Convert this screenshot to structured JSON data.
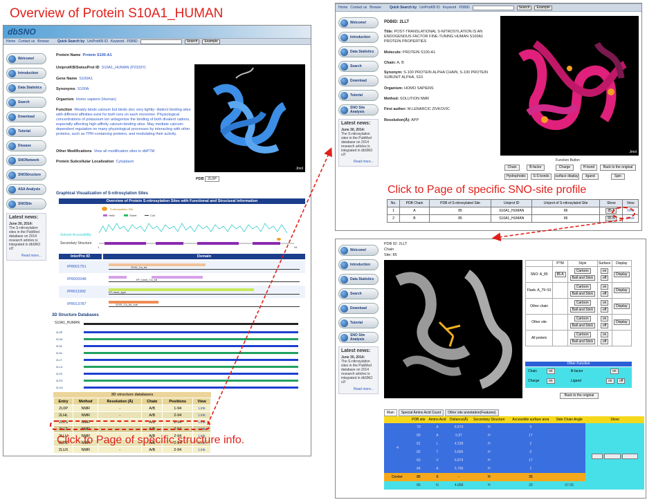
{
  "headline": "Overview of Protein S10A1_HUMAN",
  "callouts": {
    "structure": "Click to Page of specific structure info.",
    "sno": "Click to Page of specific SNO-site profile"
  },
  "nav": {
    "items": [
      "Home",
      "Contact us",
      "Browse"
    ],
    "quick_search": "Quick Search by",
    "options": [
      "UniProtKB ID",
      "Keyword",
      "PDBID"
    ],
    "search_btn": "Search",
    "example_btn": "Example"
  },
  "sidebar_main": [
    "Welcome!",
    "Introduction",
    "Data Statistics",
    "Search",
    "Download",
    "Tutorial",
    "Disease",
    "SNONetwork",
    "SNOStructure",
    "ASA Analysis",
    "SNOSite"
  ],
  "sidebar_pdb": [
    "Welcome!",
    "Introduction",
    "Data Statistics",
    "Search",
    "Download",
    "Tutorial",
    "SNO Site Analysis"
  ],
  "news": {
    "title": "Latest news:",
    "date": "June 30, 2014:",
    "text": "The S-nitrosylation sites in the PubMed database on 2014 research articles is integrated in dbSNO v2!",
    "more": "Read more..."
  },
  "protein": {
    "name_label": "Protein Name",
    "name": "Protein S100-A1",
    "uniprot_label": "UniprotKB/SwissProt ID",
    "uniprot": "S10A1_HUMAN (P23297)",
    "gene_label": "Gene Name",
    "gene": "S100A1",
    "syn_label": "Synonyms",
    "syn": "S100A",
    "org_label": "Organism",
    "org": "Homo sapiens (Human)",
    "func_label": "Function",
    "func": "Weakly binds calcium but binds zinc very tightly- distinct binding sites with different affinities exist for both ions on each monomer. Physiological concentrations of potassium ion antagonize the binding of both divalent cations, especially affecting high-affinity calcium-binding sites. May mediate calcium-dependent regulation on many physiological processes by interacting with other proteins, such as TPR-containing proteins, and modulating their activity.",
    "mod_label": "Other Modifications",
    "mod": "View all modification sites in dbPTM",
    "loc_label": "Protein Subcellular Localization",
    "loc": "Cytoplasm",
    "pdb_label": "PDB",
    "pdb_select": "2L0P",
    "jmol": "Jmol"
  },
  "graph": {
    "title": "Graphical Visualization of S-nitrosylation Sites",
    "bar": "Overview of Protein S-nitrosylation Sites with Functional and Structural Information",
    "legend_sno": "S-nitrosylation Site",
    "legend": [
      "Helix",
      "Sheet",
      "Coil"
    ],
    "asa_label": "Solvent Accessibility",
    "ss_label": "Secondary Structure",
    "start": "1",
    "end": "94"
  },
  "interpro": {
    "headers": [
      "InterPro ID",
      "Domain"
    ],
    "rows": [
      {
        "id": "IPR001751",
        "text": "S100_Ca_bd",
        "color": "#f2c299"
      },
      {
        "id": "IPR002048",
        "text": "EF_hand_Ca_bd",
        "color": "#d7a0e8"
      },
      {
        "id": "IPR011992",
        "text": "EF-hand_type",
        "color": "#c9e85a"
      },
      {
        "id": "IPR013787",
        "text": "S100_Ca_bd_sub",
        "color": "#ef8c54"
      }
    ]
  },
  "structdb": {
    "title": "3D Structure Databases",
    "ref": "S10A1_HUMAN",
    "entries": [
      "2L0P",
      "2L0U",
      "2L51",
      "2LHL",
      "2LLT",
      "2LLU",
      "2LP2",
      "2LP3",
      "2LUX"
    ],
    "table_title": "3D structure databases",
    "headers": [
      "Entry",
      "Method",
      "Resolution (Å)",
      "Chain",
      "Positions",
      "View"
    ],
    "rows": [
      [
        "2L0P",
        "NMR",
        "-",
        "A/B",
        "1-94",
        "Link"
      ],
      [
        "2LHL",
        "NMR",
        "-",
        "A/B",
        "2-94",
        "Link"
      ],
      [
        "2LLS",
        "NMR",
        "-",
        "A/B",
        "2-94",
        "Link"
      ],
      [
        "2LLT",
        "NMR",
        "-",
        "A/B",
        "2-94",
        "Link"
      ],
      [
        "2LLU",
        "NMR",
        "-",
        "A/B",
        "2-94",
        "Link"
      ],
      [
        "2LP2",
        "NMR",
        "-",
        "A/B",
        "2-94",
        "Link"
      ],
      [
        "2LUX",
        "NMR",
        "-",
        "A/B",
        "2-94",
        "Link"
      ]
    ]
  },
  "pdb": {
    "id": "PDBID: 2LLT",
    "title_label": "Title:",
    "title": "POST-TRANSLATIONAL S-NITROSYLATION IS AN ENDOGENOUS FACTOR FINE-TUNING HUMAN S100A1 PROTEIN PROPERTIES",
    "mol_label": "Molecule:",
    "mol": "PROTEIN S100-A1",
    "chain_label": "Chain:",
    "chain": "A, B",
    "syn_label": "Synonym:",
    "syn": "S-100 PROTEIN ALPHA CHAIN, S-100 PROTEIN SUBUNIT ALPHA, S10",
    "org_label": "Organism:",
    "org": "HOMO SAPIENS",
    "method_label": "Method:",
    "method": "SOLUTION NMR",
    "author_label": "First author:",
    "author": "M.LENARCIC ZIVKOVIC",
    "res_label": "Resolution(Å):",
    "res": "APP",
    "func_title": "Function Button",
    "buttons_row1": [
      "Chain",
      "B-factor",
      "Charge",
      "H-bond",
      "Back to the original"
    ],
    "buttons_row2": [
      "Hydrophobic",
      "S-S bonds",
      "surface display",
      "ligand",
      "Spin"
    ],
    "table_headers": [
      "No.",
      "PDB Chain",
      "PDB of S-nitrosylated Site",
      "Uniprot ID",
      "Uniprot of S-nitrosylated Site",
      "Show",
      "View"
    ],
    "rows": [
      [
        "1",
        "A",
        "85",
        "S10A1_HUMAN",
        "86",
        "85 A",
        "View"
      ],
      [
        "2",
        "B",
        "85",
        "S10A1_HUMAN",
        "86",
        "85 B",
        "View"
      ]
    ]
  },
  "site": {
    "pdb": "PDB ID: 2LLT",
    "chain": "Chain",
    "site": "Site: 85",
    "ctl_headers": [
      "PTM",
      "Style",
      "Surface",
      "Display"
    ],
    "ctl_rows": [
      {
        "label": "SNO: A_85",
        "ptm": "85 A",
        "style": [
          "Cartoon",
          "Ball and Stick"
        ]
      },
      {
        "label": "Flank: A_79~91",
        "ptm": "",
        "style": [
          "Cartoon",
          "Ball and Stick"
        ]
      },
      {
        "label": "Other chain",
        "ptm": "",
        "style": [
          "Cartoon",
          "Ball and Stick"
        ]
      },
      {
        "label": "Other site",
        "ptm": "",
        "style": [
          "Cartoon",
          "Ball and Stick"
        ]
      },
      {
        "label": "All protein",
        "ptm": "",
        "style": [
          "Cartoon",
          "Ball and Stick"
        ]
      }
    ],
    "on": "on",
    "off": "off",
    "display": "Display",
    "other_func": "Other Function",
    "bfactor": "B-factor",
    "charge": "Charge",
    "ligand": "Ligand",
    "back": "Back to the original",
    "tabs": [
      "Main",
      "Special Amino Acid Count",
      "Other site annotation(Features)"
    ],
    "tbl_headers": [
      "PDB site",
      "Amino Acid",
      "Distance(Å)",
      "Secondary Structure",
      "Accessible surface area",
      "Side Chain Angle",
      "Show"
    ],
    "rows": [
      [
        "79",
        "A",
        "8.879",
        "H",
        "0",
        ""
      ],
      [
        "80",
        "A",
        "6.87",
        "H",
        "17",
        ""
      ],
      [
        "81",
        "L",
        "4.238",
        "H",
        "2",
        ""
      ],
      [
        "82",
        "T",
        "5.896",
        "H",
        "0",
        ""
      ],
      [
        "83",
        "V",
        "6.879",
        "H",
        "17",
        ""
      ],
      [
        "84",
        "A",
        "5.796",
        "H",
        "1",
        ""
      ],
      [
        "85",
        "X",
        "-",
        "H",
        "35",
        ""
      ],
      [
        "86",
        "N",
        "4.688",
        "H",
        "28",
        "67.06"
      ]
    ],
    "group_label": "-4",
    "center": "Center",
    "view": "View",
    "label_on": "label on",
    "label_off": "label off"
  }
}
